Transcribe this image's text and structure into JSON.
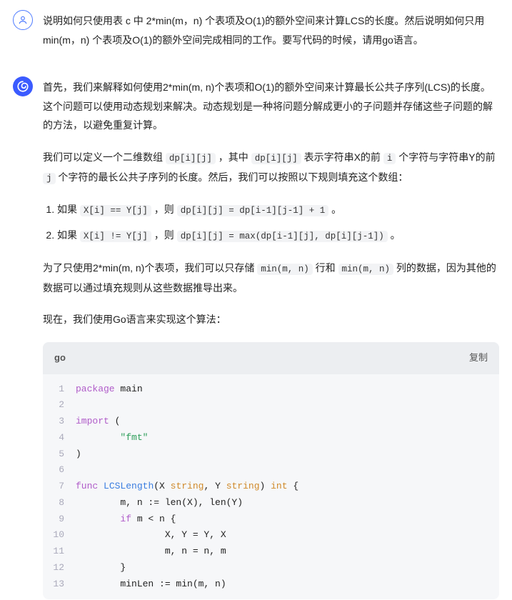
{
  "user": {
    "text": "说明如何只使用表 c 中 2*min(m，n) 个表项及O(1)的额外空间来计算LCS的长度。然后说明如何只用 min(m，n) 个表项及O(1)的额外空间完成相同的工作。要写代码的时候，请用go语言。"
  },
  "bot": {
    "para1_a": "首先，我们来解释如何使用2*min(m, n)个表项和O(1)的额外空间来计算最长公共子序列(LCS)的长度。这个问题可以使用动态规划来解决。动态规划是一种将问题分解成更小的子问题并存储这些子问题的解的方法，以避免重复计算。",
    "para2_pre": "我们可以定义一个二维数组 ",
    "para2_c1": "dp[i][j]",
    "para2_mid1": " ，其中 ",
    "para2_c2": "dp[i][j]",
    "para2_mid2": " 表示字符串X的前 ",
    "para2_c3": "i",
    "para2_mid3": " 个字符与字符串Y的前 ",
    "para2_c4": "j",
    "para2_mid4": " 个字符的最长公共子序列的长度。然后，我们可以按照以下规则填充这个数组：",
    "rule1_pre": "如果 ",
    "rule1_c1": "X[i] == Y[j]",
    "rule1_mid": " ，则 ",
    "rule1_c2": "dp[i][j] = dp[i-1][j-1] + 1",
    "rule1_end": " 。",
    "rule2_pre": "如果 ",
    "rule2_c1": "X[i] != Y[j]",
    "rule2_mid": " ，则 ",
    "rule2_c2": "dp[i][j] = max(dp[i-1][j], dp[i][j-1])",
    "rule2_end": " 。",
    "para3_pre": "为了只使用2*min(m, n)个表项，我们可以只存储 ",
    "para3_c1": "min(m, n)",
    "para3_mid1": " 行和 ",
    "para3_c2": "min(m, n)",
    "para3_mid2": " 列的数据，因为其他的数据可以通过填充规则从这些数据推导出来。",
    "para4": "现在，我们使用Go语言来实现这个算法：",
    "lang": "go",
    "copy": "复制",
    "code_kw": {
      "package": "package",
      "import": "import",
      "func": "func",
      "if": "if"
    },
    "code_id": {
      "main": "main",
      "fmt": "\"fmt\"",
      "LCSLength": "LCSLength",
      "string": "string",
      "int": "int"
    },
    "codeLines": {
      "l1a": "package",
      "l1b": " main",
      "l3a": "import",
      "l3b": " (",
      "l4": "        \"fmt\"",
      "l5": ")",
      "l7a": "func",
      "l7b": " ",
      "l7c": "LCSLength",
      "l7d": "(X ",
      "l7e": "string",
      "l7f": ", Y ",
      "l7g": "string",
      "l7h": ") ",
      "l7i": "int",
      "l7j": " {",
      "l8": "        m, n := len(X), len(Y)",
      "l9a": "        ",
      "l9b": "if",
      "l9c": " m < n {",
      "l10": "                X, Y = Y, X",
      "l11": "                m, n = n, m",
      "l12": "        }",
      "l13": "        minLen := min(m, n)"
    },
    "gutters": [
      "1",
      "2",
      "3",
      "4",
      "5",
      "6",
      "7",
      "8",
      "9",
      "10",
      "11",
      "12",
      "13"
    ]
  }
}
